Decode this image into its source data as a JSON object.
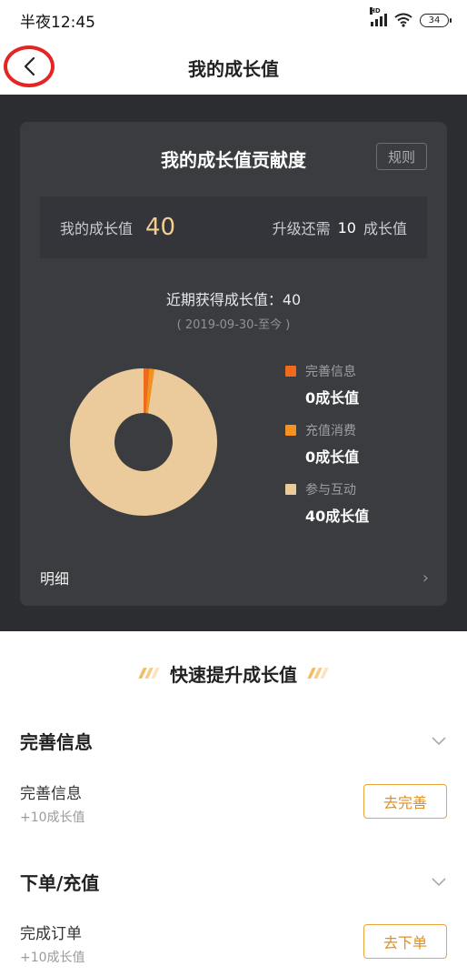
{
  "status_bar": {
    "time": "半夜12:45",
    "battery": "34",
    "network_label": "HD"
  },
  "nav": {
    "title": "我的成长值"
  },
  "card": {
    "title": "我的成长值贡献度",
    "rules_label": "规则",
    "my_value_label": "我的成长值",
    "my_value": "40",
    "upgrade_prefix": "升级还需",
    "upgrade_value": "10",
    "upgrade_suffix": "成长值",
    "recent_label": "近期获得成长值：40",
    "date_range": "( 2019-09-30-至今 )",
    "detail_label": "明细"
  },
  "chart_data": {
    "type": "pie",
    "categories": [
      "完善信息",
      "充值消费",
      "参与互动"
    ],
    "values": [
      0,
      0,
      40
    ],
    "colors": [
      "#f06a1b",
      "#f5921e",
      "#ebcb9b"
    ]
  },
  "legend": [
    {
      "label": "完善信息",
      "value": "0成长值",
      "color": "#f06a1b"
    },
    {
      "label": "充值消费",
      "value": "0成长值",
      "color": "#f5921e"
    },
    {
      "label": "参与互动",
      "value": "40成长值",
      "color": "#ebcb9b"
    }
  ],
  "quick": {
    "title": "快速提升成长值",
    "groups": [
      {
        "title": "完善信息",
        "task_name": "完善信息",
        "task_reward": "+10成长值",
        "button": "去完善"
      },
      {
        "title": "下单/充值",
        "task_name": "完成订单",
        "task_reward": "+10成长值",
        "button": "去下单"
      }
    ]
  }
}
